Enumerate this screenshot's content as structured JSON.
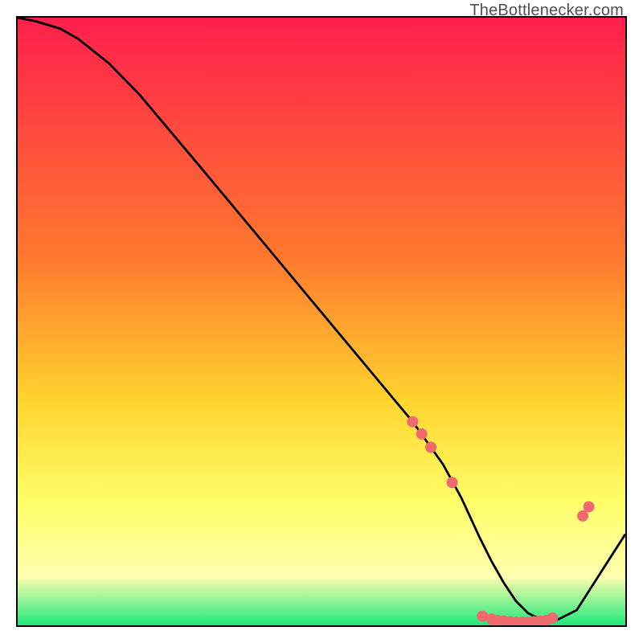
{
  "watermark": "TheBottlenecker.com",
  "colors": {
    "grad_top": "#ff1f4c",
    "grad_mid1": "#ff7a2e",
    "grad_mid2": "#ffd42e",
    "grad_mid3": "#ffff6a",
    "grad_mid4": "#ffffb0",
    "grad_bot": "#1fe87a",
    "curve": "#000000",
    "marker": "#ef6a6f",
    "frame": "#000000"
  },
  "chart_data": {
    "type": "line",
    "title": "",
    "xlabel": "",
    "ylabel": "",
    "xlim": [
      0,
      100
    ],
    "ylim": [
      0,
      100
    ],
    "curve": {
      "x": [
        0,
        3,
        7,
        10,
        15,
        20,
        30,
        40,
        50,
        60,
        65,
        70,
        73,
        76,
        78,
        80,
        82,
        84,
        86,
        88,
        92,
        100
      ],
      "y": [
        100,
        99.4,
        98.2,
        96.5,
        92.5,
        87.4,
        75.5,
        63.5,
        51.5,
        39.5,
        33.5,
        26.5,
        21,
        14.5,
        10.5,
        7,
        4,
        2,
        1,
        0.5,
        2.5,
        15
      ]
    },
    "markers": [
      {
        "x": 65,
        "y": 33.5
      },
      {
        "x": 66.5,
        "y": 31.5
      },
      {
        "x": 68,
        "y": 29.3
      },
      {
        "x": 71.5,
        "y": 23.5
      },
      {
        "x": 76.5,
        "y": 1.5
      },
      {
        "x": 78,
        "y": 1
      },
      {
        "x": 79,
        "y": 0.8
      },
      {
        "x": 80,
        "y": 0.7
      },
      {
        "x": 81,
        "y": 0.6
      },
      {
        "x": 82,
        "y": 0.5
      },
      {
        "x": 83,
        "y": 0.5
      },
      {
        "x": 84,
        "y": 0.5
      },
      {
        "x": 85,
        "y": 0.6
      },
      {
        "x": 86,
        "y": 0.7
      },
      {
        "x": 87,
        "y": 0.8
      },
      {
        "x": 88,
        "y": 1.2
      },
      {
        "x": 93,
        "y": 18
      },
      {
        "x": 94,
        "y": 19.5
      }
    ]
  }
}
